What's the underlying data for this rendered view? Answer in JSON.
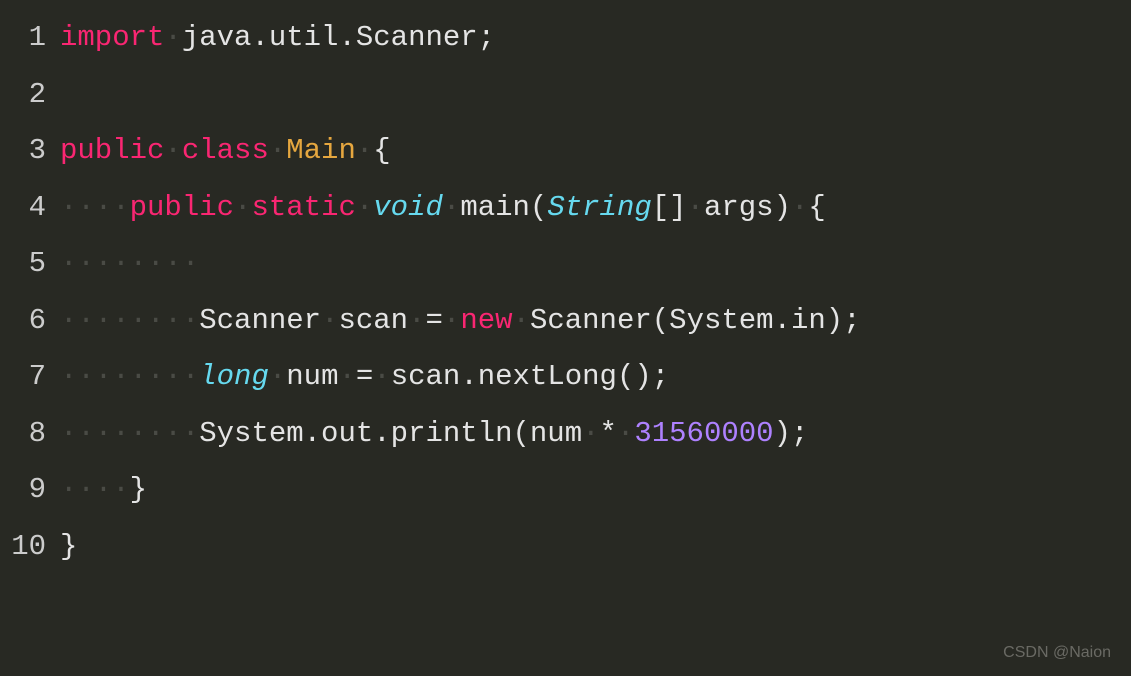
{
  "gutter": [
    "1",
    "2",
    "3",
    "4",
    "5",
    "6",
    "7",
    "8",
    "9",
    "10"
  ],
  "lines": {
    "l1": {
      "t1": "import",
      "t2": "·",
      "t3": "java.util.Scanner;"
    },
    "l2": "",
    "l3": {
      "t1": "public",
      "t2": "·",
      "t3": "class",
      "t4": "·",
      "t5": "Main",
      "t6": "·",
      "t7": "{"
    },
    "l4": {
      "t1": "····",
      "t2": "public",
      "t3": "·",
      "t4": "static",
      "t5": "·",
      "t6": "void",
      "t7": "·",
      "t8": "main(",
      "t9": "String",
      "t10": "[]",
      "t11": "·",
      "t12": "args)",
      "t13": "·",
      "t14": "{"
    },
    "l5": {
      "t1": "········"
    },
    "l6": {
      "t1": "········",
      "t2": "Scanner",
      "t3": "·",
      "t4": "scan",
      "t5": "·",
      "t6": "=",
      "t7": "·",
      "t8": "new",
      "t9": "·",
      "t10": "Scanner(System.in);"
    },
    "l7": {
      "t1": "········",
      "t2": "long",
      "t3": "·",
      "t4": "num",
      "t5": "·",
      "t6": "=",
      "t7": "·",
      "t8": "scan.nextLong();"
    },
    "l8": {
      "t1": "········",
      "t2": "System.out.println(num",
      "t3": "·",
      "t4": "*",
      "t5": "·",
      "t6": "31560000",
      "t7": ");"
    },
    "l9": {
      "t1": "····",
      "t2": "}"
    },
    "l10": {
      "t1": "}"
    }
  },
  "watermark": "CSDN @Naion"
}
